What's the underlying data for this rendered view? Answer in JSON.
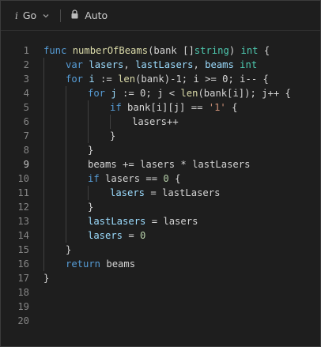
{
  "toolbar": {
    "language_icon": "i",
    "language": "Go",
    "lock_icon": "lock-icon",
    "mode": "Auto"
  },
  "code": {
    "lines": [
      {
        "n": "1",
        "indent": 0,
        "tokens": [
          [
            "kw",
            "func "
          ],
          [
            "fn",
            "numberOfBeams"
          ],
          [
            "pl",
            "(bank []"
          ],
          [
            "ty",
            "string"
          ],
          [
            "pl",
            ") "
          ],
          [
            "ty",
            "int"
          ],
          [
            "pl",
            " {"
          ]
        ]
      },
      {
        "n": "2",
        "indent": 1,
        "tokens": [
          [
            "kw",
            "var "
          ],
          [
            "va",
            "lasers"
          ],
          [
            "pl",
            ", "
          ],
          [
            "va",
            "lastLasers"
          ],
          [
            "pl",
            ", "
          ],
          [
            "va",
            "beams"
          ],
          [
            "pl",
            " "
          ],
          [
            "ty",
            "int"
          ]
        ]
      },
      {
        "n": "3",
        "indent": 1,
        "tokens": [
          [
            "kw",
            "for "
          ],
          [
            "va",
            "i"
          ],
          [
            "pl",
            " := "
          ],
          [
            "fn",
            "len"
          ],
          [
            "pl",
            "(bank)-1; i >= 0; i-- {"
          ]
        ]
      },
      {
        "n": "4",
        "indent": 2,
        "tokens": [
          [
            "kw",
            "for "
          ],
          [
            "va",
            "j"
          ],
          [
            "pl",
            " := 0; j < "
          ],
          [
            "fn",
            "len"
          ],
          [
            "pl",
            "(bank[i]); j++ {"
          ]
        ]
      },
      {
        "n": "5",
        "indent": 3,
        "tokens": [
          [
            "kw",
            "if "
          ],
          [
            "pl",
            "bank[i][j] == "
          ],
          [
            "st",
            "'1'"
          ],
          [
            "pl",
            " {"
          ]
        ]
      },
      {
        "n": "6",
        "indent": 4,
        "tokens": [
          [
            "pl",
            "lasers++"
          ]
        ]
      },
      {
        "n": "7",
        "indent": 3,
        "tokens": [
          [
            "pl",
            "}"
          ]
        ]
      },
      {
        "n": "8",
        "indent": 2,
        "tokens": [
          [
            "pl",
            "}"
          ]
        ]
      },
      {
        "n": "9",
        "indent": 2,
        "tokens": [
          [
            "pl",
            "beams += lasers * lastLasers"
          ]
        ],
        "current": true
      },
      {
        "n": "10",
        "indent": 2,
        "tokens": [
          [
            "kw",
            "if "
          ],
          [
            "pl",
            "lasers == "
          ],
          [
            "nu",
            "0"
          ],
          [
            "pl",
            " {"
          ]
        ]
      },
      {
        "n": "11",
        "indent": 3,
        "tokens": [
          [
            "va",
            "lasers"
          ],
          [
            "pl",
            " = lastLasers"
          ]
        ]
      },
      {
        "n": "12",
        "indent": 2,
        "tokens": [
          [
            "pl",
            "}"
          ]
        ]
      },
      {
        "n": "13",
        "indent": 2,
        "tokens": [
          [
            "va",
            "lastLasers"
          ],
          [
            "pl",
            " = lasers"
          ]
        ]
      },
      {
        "n": "14",
        "indent": 2,
        "tokens": [
          [
            "va",
            "lasers"
          ],
          [
            "pl",
            " = "
          ],
          [
            "nu",
            "0"
          ]
        ]
      },
      {
        "n": "15",
        "indent": 1,
        "tokens": [
          [
            "pl",
            "}"
          ]
        ]
      },
      {
        "n": "16",
        "indent": 1,
        "tokens": [
          [
            "kw",
            "return "
          ],
          [
            "pl",
            "beams"
          ]
        ]
      },
      {
        "n": "17",
        "indent": 0,
        "tokens": [
          [
            "pl",
            "}"
          ]
        ]
      },
      {
        "n": "18",
        "indent": 0,
        "tokens": []
      },
      {
        "n": "19",
        "indent": 0,
        "tokens": []
      },
      {
        "n": "20",
        "indent": 0,
        "tokens": []
      }
    ]
  }
}
